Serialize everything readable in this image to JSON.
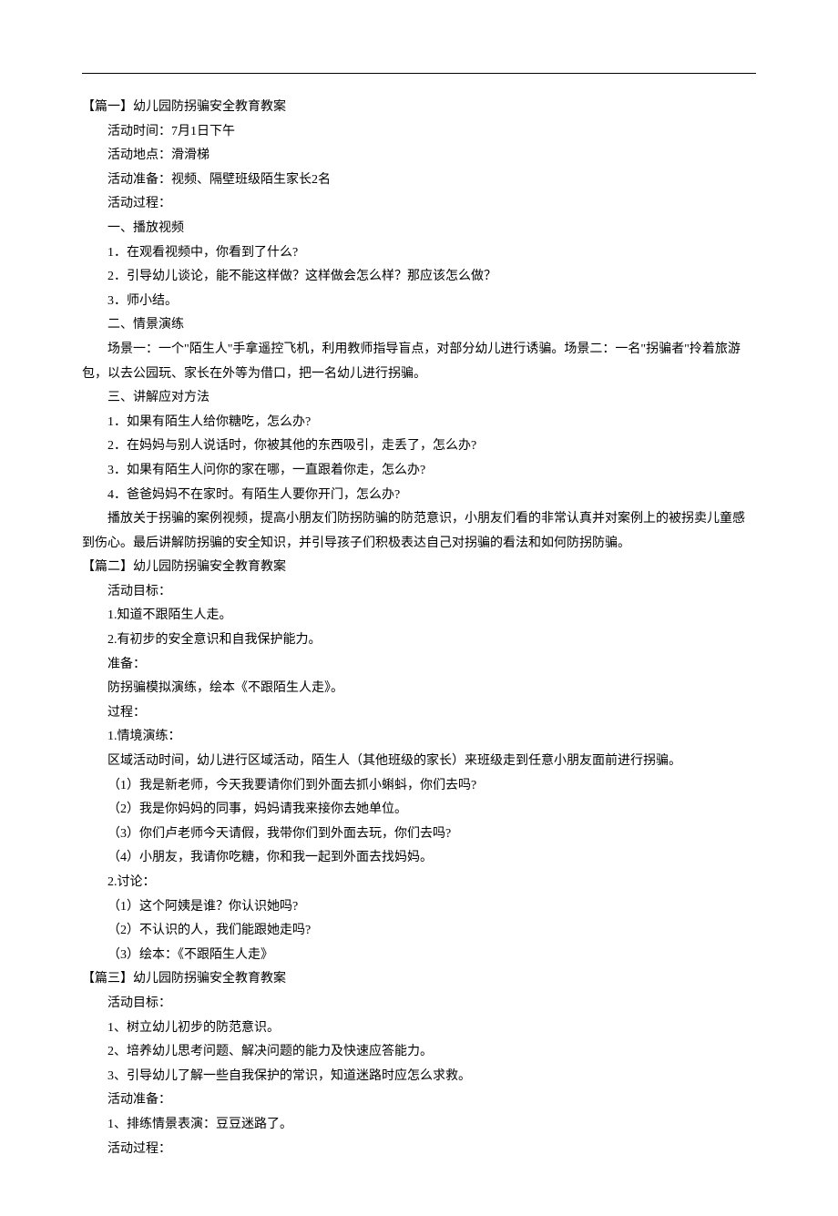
{
  "section1": {
    "title": "【篇一】幼儿园防拐骗安全教育教案",
    "lines": [
      "活动时间：7月1日下午",
      "活动地点：滑滑梯",
      "活动准备：视频、隔壁班级陌生家长2名",
      "活动过程：",
      "一、播放视频",
      "1．在观看视频中，你看到了什么?",
      "2．引导幼儿谈论，能不能这样做？这样做会怎么样？那应该怎么做？",
      "3．师小结。",
      "二、情景演练",
      "场景一：一个\"陌生人\"手拿遥控飞机，利用教师指导盲点，对部分幼儿进行诱骗。场景二：一名\"拐骗者\"拎着旅游"
    ],
    "wrap1": "包，以去公园玩、家长在外等为借口，把一名幼儿进行拐骗。",
    "lines2": [
      "三、讲解应对方法",
      "1．如果有陌生人给你糖吃，怎么办?",
      "2．在妈妈与别人说话时，你被其他的东西吸引，走丢了，怎么办?",
      "3．如果有陌生人问你的家在哪，一直跟着你走，怎么办?",
      "4．爸爸妈妈不在家时。有陌生人要你开门，怎么办?",
      "播放关于拐骗的案例视频，提高小朋友们防拐防骗的防范意识，小朋友们看的非常认真并对案例上的被拐卖儿童感"
    ],
    "wrap2": "到伤心。最后讲解防拐骗的安全知识，并引导孩子们积极表达自己对拐骗的看法和如何防拐防骗。"
  },
  "section2": {
    "title": "【篇二】幼儿园防拐骗安全教育教案",
    "lines": [
      "活动目标：",
      "1.知道不跟陌生人走。",
      "2.有初步的安全意识和自我保护能力。",
      "准备：",
      "防拐骗模拟演练，绘本《不跟陌生人走》。",
      "过程：",
      "1.情境演练：",
      "区域活动时间，幼儿进行区域活动，陌生人（其他班级的家长）来班级走到任意小朋友面前进行拐骗。",
      "（1）我是新老师，今天我要请你们到外面去抓小蝌蚪，你们去吗?",
      "（2）我是你妈妈的同事，妈妈请我来接你去她单位。",
      "（3）你们卢老师今天请假，我带你们到外面去玩，你们去吗?",
      "（4）小朋友，我请你吃糖，你和我一起到外面去找妈妈。",
      "2.讨论：",
      "（1）这个阿姨是谁？你认识她吗?",
      "（2）不认识的人，我们能跟她走吗?",
      "（3）绘本：《不跟陌生人走》"
    ]
  },
  "section3": {
    "title": "【篇三】幼儿园防拐骗安全教育教案",
    "lines": [
      "活动目标：",
      "1、树立幼儿初步的防范意识。",
      "2、培养幼儿思考问题、解决问题的能力及快速应答能力。",
      "3、引导幼儿了解一些自我保护的常识，知道迷路时应怎么求救。",
      "活动准备：",
      "1、排练情景表演：豆豆迷路了。",
      "活动过程："
    ]
  }
}
